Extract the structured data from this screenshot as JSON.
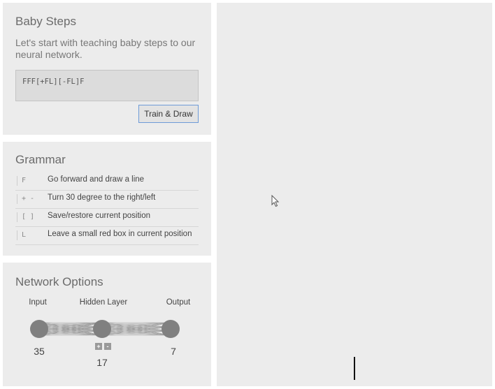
{
  "baby_steps": {
    "title": "Baby Steps",
    "description": "Let's start with teaching baby steps to our neural network.",
    "code": "FFF[+FL][-FL]F",
    "train_button": "Train & Draw",
    "button_border_color": "#6e9bd8"
  },
  "grammar": {
    "title": "Grammar",
    "rows": [
      {
        "symbol": "F",
        "description": "Go forward and draw a line"
      },
      {
        "symbol": "+ -",
        "description": "Turn 30 degree to the right/left"
      },
      {
        "symbol": "[ ]",
        "description": "Save/restore current position"
      },
      {
        "symbol": "L",
        "description": "Leave a small red box in current position"
      }
    ]
  },
  "network": {
    "title": "Network Options",
    "input_label": "Input",
    "hidden_label": "Hidden Layer",
    "output_label": "Output",
    "input_size": "35",
    "hidden_size": "17",
    "output_size": "7",
    "add_label": "+",
    "remove_label": "-",
    "node_color": "#808080"
  },
  "canvas": {
    "background": "#ececec"
  }
}
